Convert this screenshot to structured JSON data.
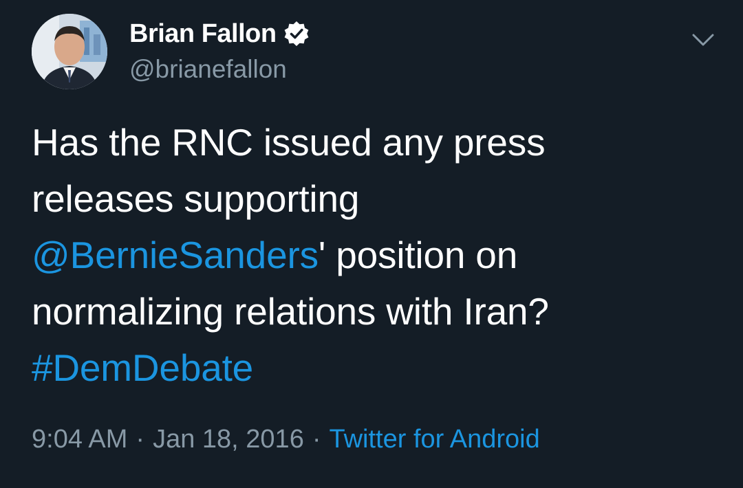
{
  "tweet": {
    "author": {
      "name": "Brian Fallon",
      "handle": "@brianefallon",
      "verified": true
    },
    "text_lines": [
      [
        {
          "text": "Has the RNC issued any press",
          "kind": "text"
        }
      ],
      [
        {
          "text": "releases supporting",
          "kind": "text"
        }
      ],
      [
        {
          "text": "@BernieSanders",
          "kind": "mention"
        },
        {
          "text": "' position on",
          "kind": "text"
        }
      ],
      [
        {
          "text": "normalizing relations with Iran?",
          "kind": "text"
        }
      ],
      [
        {
          "text": "#DemDebate",
          "kind": "hashtag"
        }
      ]
    ],
    "time": "9:04 AM",
    "date": "Jan 18, 2016",
    "separator": "·",
    "source": "Twitter for Android"
  },
  "icons": {
    "verified": "verified-badge-icon",
    "menu": "chevron-down-icon"
  },
  "colors": {
    "background": "#141d26",
    "text": "#ffffff",
    "secondary": "#8899a6",
    "link": "#1b95e0"
  }
}
